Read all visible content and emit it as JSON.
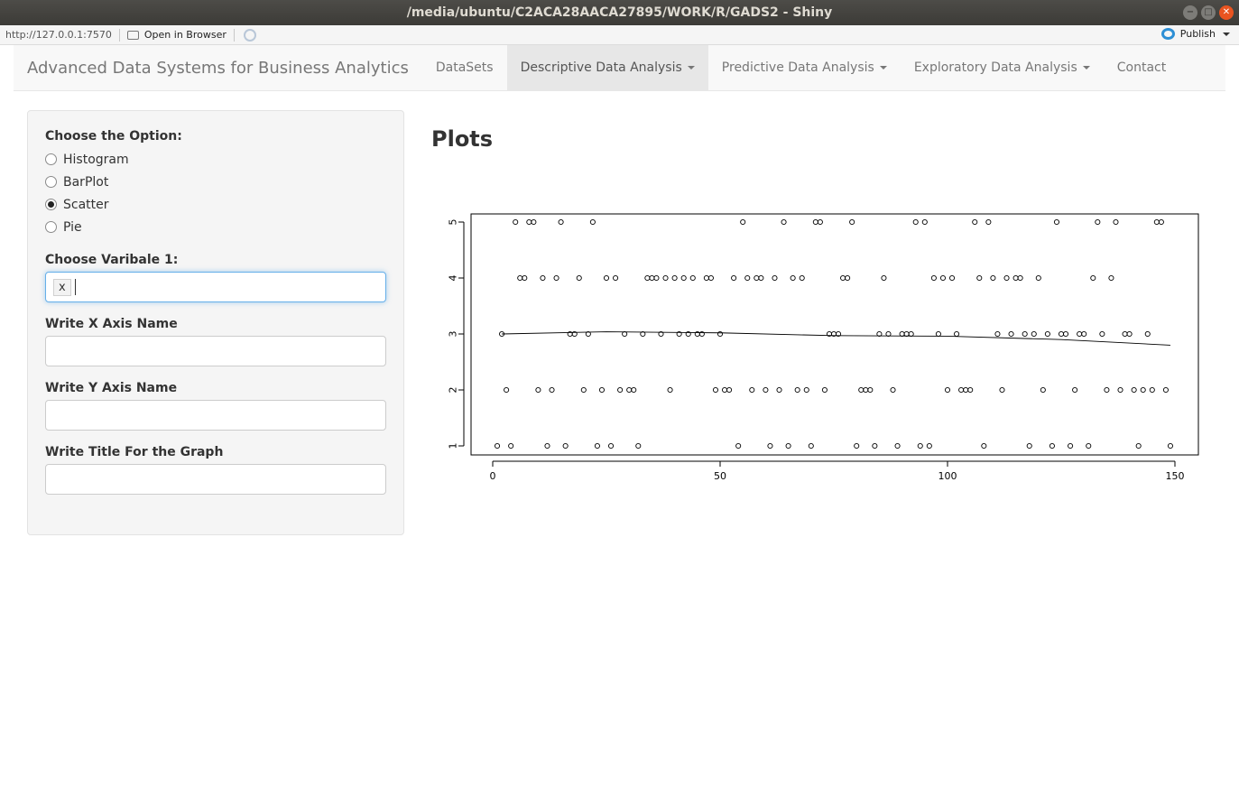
{
  "window": {
    "title": "/media/ubuntu/C2ACA28AACA27895/WORK/R/GADS2 - Shiny",
    "buttons": [
      "−",
      "□",
      "✕"
    ]
  },
  "toolbar": {
    "url": "http://127.0.0.1:7570",
    "open_in_browser": "Open in Browser",
    "publish": "Publish"
  },
  "navbar": {
    "brand": "Advanced Data Systems for Business Analytics",
    "items": [
      {
        "label": "DataSets",
        "dropdown": false
      },
      {
        "label": "Descriptive Data Analysis",
        "dropdown": true,
        "active": true
      },
      {
        "label": "Predictive Data Analysis",
        "dropdown": true
      },
      {
        "label": "Exploratory Data Analysis",
        "dropdown": true
      },
      {
        "label": "Contact",
        "dropdown": false
      }
    ]
  },
  "sidebar": {
    "option_label": "Choose the Option:",
    "options": [
      "Histogram",
      "BarPlot",
      "Scatter",
      "Pie"
    ],
    "selected_option": "Scatter",
    "var1_label": "Choose Varibale 1:",
    "var1_value": "x",
    "xaxis_label": "Write X Axis Name",
    "xaxis_value": "",
    "yaxis_label": "Write Y Axis Name",
    "yaxis_value": "",
    "title_label": "Write Title For the Graph",
    "title_value": ""
  },
  "main": {
    "heading": "Plots"
  },
  "chart_data": {
    "type": "scatter",
    "title": "",
    "xlabel": "",
    "ylabel": "",
    "xlim": [
      0,
      150
    ],
    "ylim": [
      1,
      5
    ],
    "x_ticks": [
      0,
      50,
      100,
      150
    ],
    "y_ticks": [
      1,
      2,
      3,
      4,
      5
    ],
    "grid": false,
    "smooth_line": [
      [
        2,
        3.0
      ],
      [
        25,
        3.04
      ],
      [
        50,
        3.02
      ],
      [
        75,
        2.97
      ],
      [
        100,
        2.96
      ],
      [
        125,
        2.9
      ],
      [
        149,
        2.8
      ]
    ],
    "points": [
      [
        1,
        1
      ],
      [
        4,
        1
      ],
      [
        12,
        1
      ],
      [
        16,
        1
      ],
      [
        23,
        1
      ],
      [
        26,
        1
      ],
      [
        32,
        1
      ],
      [
        54,
        1
      ],
      [
        61,
        1
      ],
      [
        65,
        1
      ],
      [
        70,
        1
      ],
      [
        80,
        1
      ],
      [
        84,
        1
      ],
      [
        89,
        1
      ],
      [
        94,
        1
      ],
      [
        96,
        1
      ],
      [
        108,
        1
      ],
      [
        118,
        1
      ],
      [
        123,
        1
      ],
      [
        127,
        1
      ],
      [
        131,
        1
      ],
      [
        142,
        1
      ],
      [
        149,
        1
      ],
      [
        3,
        2
      ],
      [
        10,
        2
      ],
      [
        13,
        2
      ],
      [
        20,
        2
      ],
      [
        24,
        2
      ],
      [
        28,
        2
      ],
      [
        30,
        2
      ],
      [
        31,
        2
      ],
      [
        39,
        2
      ],
      [
        49,
        2
      ],
      [
        51,
        2
      ],
      [
        52,
        2
      ],
      [
        57,
        2
      ],
      [
        60,
        2
      ],
      [
        63,
        2
      ],
      [
        67,
        2
      ],
      [
        69,
        2
      ],
      [
        73,
        2
      ],
      [
        81,
        2
      ],
      [
        82,
        2
      ],
      [
        83,
        2
      ],
      [
        88,
        2
      ],
      [
        100,
        2
      ],
      [
        103,
        2
      ],
      [
        104,
        2
      ],
      [
        105,
        2
      ],
      [
        112,
        2
      ],
      [
        121,
        2
      ],
      [
        128,
        2
      ],
      [
        135,
        2
      ],
      [
        138,
        2
      ],
      [
        141,
        2
      ],
      [
        143,
        2
      ],
      [
        145,
        2
      ],
      [
        148,
        2
      ],
      [
        2,
        3
      ],
      [
        17,
        3
      ],
      [
        18,
        3
      ],
      [
        21,
        3
      ],
      [
        29,
        3
      ],
      [
        33,
        3
      ],
      [
        37,
        3
      ],
      [
        41,
        3
      ],
      [
        43,
        3
      ],
      [
        45,
        3
      ],
      [
        46,
        3
      ],
      [
        50,
        3
      ],
      [
        74,
        3
      ],
      [
        75,
        3
      ],
      [
        76,
        3
      ],
      [
        85,
        3
      ],
      [
        87,
        3
      ],
      [
        90,
        3
      ],
      [
        91,
        3
      ],
      [
        92,
        3
      ],
      [
        98,
        3
      ],
      [
        102,
        3
      ],
      [
        111,
        3
      ],
      [
        114,
        3
      ],
      [
        117,
        3
      ],
      [
        119,
        3
      ],
      [
        122,
        3
      ],
      [
        125,
        3
      ],
      [
        126,
        3
      ],
      [
        129,
        3
      ],
      [
        130,
        3
      ],
      [
        134,
        3
      ],
      [
        139,
        3
      ],
      [
        140,
        3
      ],
      [
        144,
        3
      ],
      [
        6,
        4
      ],
      [
        7,
        4
      ],
      [
        11,
        4
      ],
      [
        14,
        4
      ],
      [
        19,
        4
      ],
      [
        25,
        4
      ],
      [
        27,
        4
      ],
      [
        34,
        4
      ],
      [
        35,
        4
      ],
      [
        36,
        4
      ],
      [
        38,
        4
      ],
      [
        40,
        4
      ],
      [
        42,
        4
      ],
      [
        44,
        4
      ],
      [
        47,
        4
      ],
      [
        48,
        4
      ],
      [
        53,
        4
      ],
      [
        56,
        4
      ],
      [
        58,
        4
      ],
      [
        59,
        4
      ],
      [
        62,
        4
      ],
      [
        66,
        4
      ],
      [
        68,
        4
      ],
      [
        77,
        4
      ],
      [
        78,
        4
      ],
      [
        86,
        4
      ],
      [
        97,
        4
      ],
      [
        99,
        4
      ],
      [
        101,
        4
      ],
      [
        107,
        4
      ],
      [
        110,
        4
      ],
      [
        113,
        4
      ],
      [
        115,
        4
      ],
      [
        116,
        4
      ],
      [
        120,
        4
      ],
      [
        132,
        4
      ],
      [
        136,
        4
      ],
      [
        5,
        5
      ],
      [
        8,
        5
      ],
      [
        9,
        5
      ],
      [
        15,
        5
      ],
      [
        22,
        5
      ],
      [
        55,
        5
      ],
      [
        64,
        5
      ],
      [
        71,
        5
      ],
      [
        72,
        5
      ],
      [
        79,
        5
      ],
      [
        93,
        5
      ],
      [
        95,
        5
      ],
      [
        106,
        5
      ],
      [
        109,
        5
      ],
      [
        124,
        5
      ],
      [
        133,
        5
      ],
      [
        137,
        5
      ],
      [
        146,
        5
      ],
      [
        147,
        5
      ]
    ]
  }
}
